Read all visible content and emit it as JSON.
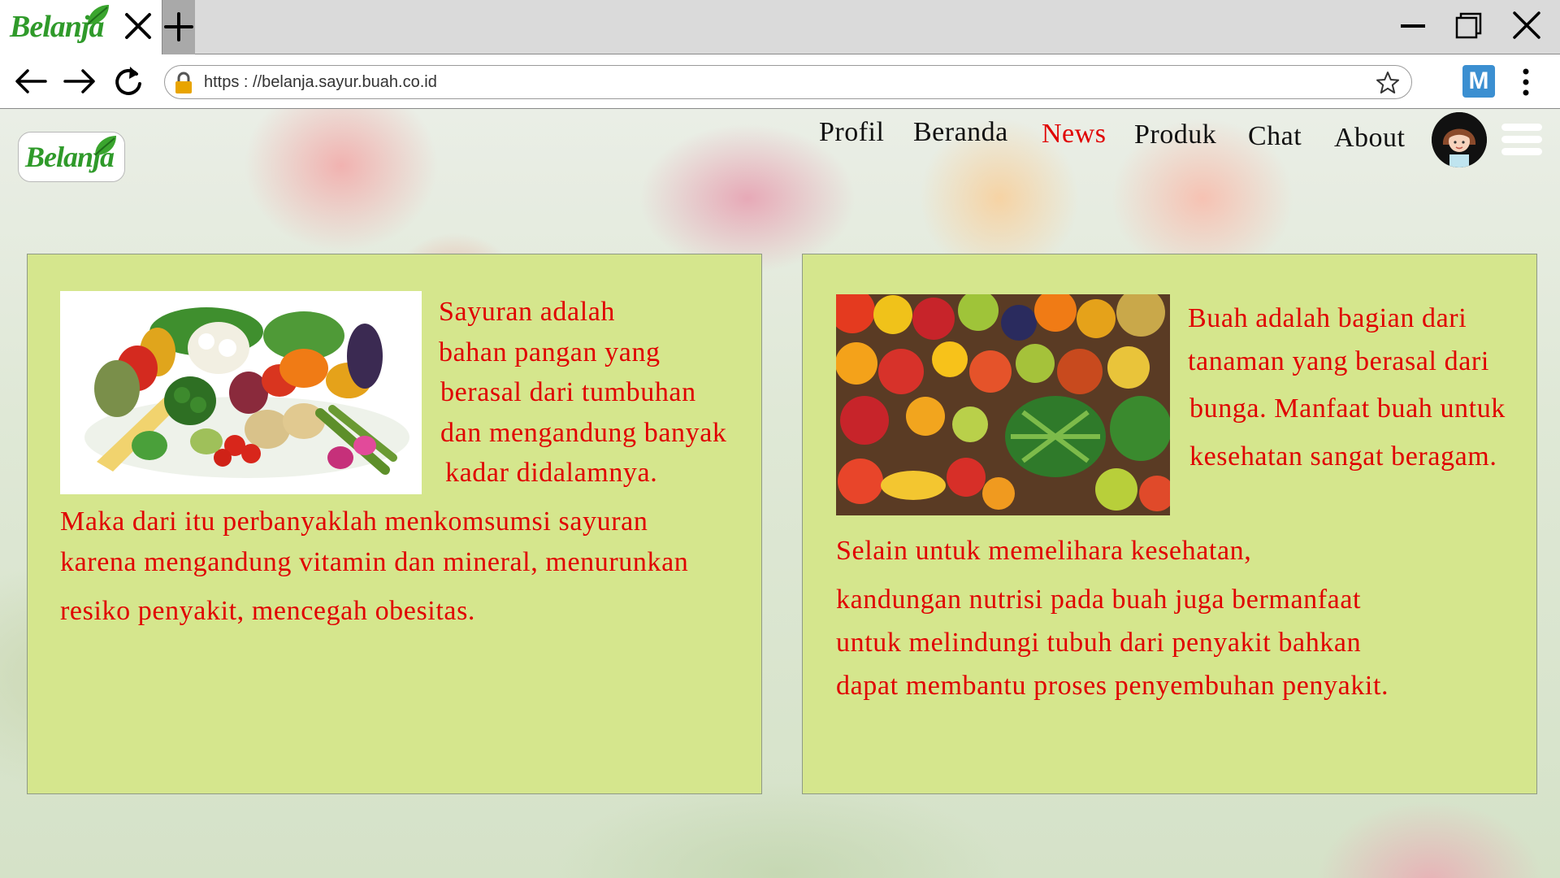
{
  "browser": {
    "tab_logo_text": "Belanja",
    "url": "https : //belanja.sayur.buah.co.id",
    "extension_label": "M"
  },
  "site": {
    "logo_text": "Belanja",
    "nav": {
      "profil": "Profil",
      "beranda": "Beranda",
      "news": "News",
      "produk": "Produk",
      "chat": "Chat",
      "about": "About"
    },
    "active_nav": "News",
    "accent_color": "#e00000",
    "card_color": "#d5e68d"
  },
  "cards": {
    "sayur": {
      "image": "vegetables-photo",
      "lines": [
        "Sayuran adalah",
        "bahan pangan yang",
        "berasal dari tumbuhan",
        "dan mengandung banyak",
        "kadar didalamnya.",
        "Maka dari itu perbanyaklah menkomsumsi sayuran",
        "karena mengandung vitamin dan mineral, menurunkan",
        "resiko penyakit, mencegah obesitas."
      ]
    },
    "buah": {
      "image": "fruits-photo",
      "lines": [
        "Buah adalah bagian dari",
        "tanaman yang berasal dari",
        "bunga. Manfaat buah untuk",
        "kesehatan sangat beragam.",
        "Selain untuk memelihara kesehatan,",
        "kandungan nutrisi pada buah juga bermanfaat",
        "untuk melindungi tubuh dari penyakit bahkan",
        "dapat membantu proses penyembuhan penyakit."
      ]
    }
  }
}
